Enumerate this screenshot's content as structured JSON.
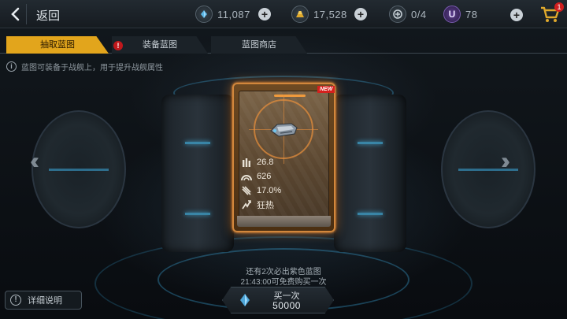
{
  "header": {
    "back_label": "返回",
    "crystal": {
      "icon": "crystal-icon",
      "value": "11,087"
    },
    "gold": {
      "icon": "gold-bar-icon",
      "value": "17,528"
    },
    "blueprint_slots": {
      "icon": "blueprint-icon",
      "value": "0/4"
    },
    "u_currency": {
      "icon": "u-coin-icon",
      "letter": "U",
      "value": "78"
    },
    "cart_badge": "1"
  },
  "tabs": [
    {
      "label": "抽取蓝图",
      "active": true
    },
    {
      "label": "装备蓝图",
      "alert": "!"
    },
    {
      "label": "蓝图商店"
    }
  ],
  "info": {
    "icon": "info-icon",
    "text": "蓝图可装备于战舰上，用于提升战舰属性"
  },
  "card": {
    "badge": "NEW",
    "stats": [
      {
        "icon": "ammo-icon",
        "value": "26.8"
      },
      {
        "icon": "shield-arc-icon",
        "value": "626"
      },
      {
        "icon": "missile-icon",
        "value": "17.0%"
      },
      {
        "icon": "frenzy-icon",
        "value": "狂热"
      }
    ]
  },
  "notes": {
    "line1": "还有2次必出紫色蓝图",
    "line2": "21:43:00可免费购买一次"
  },
  "help": {
    "label": "详细说明"
  },
  "buy": {
    "label": "买一次",
    "price": "50000"
  },
  "colors": {
    "accent": "#e2a51c",
    "card_glow": "#ff9a3c",
    "badge_red": "#d5201d"
  }
}
